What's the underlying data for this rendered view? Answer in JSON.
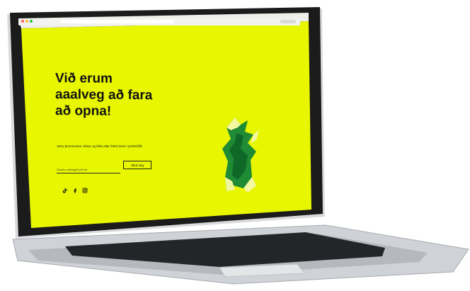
{
  "browser": {
    "dots": [
      "#ff5f57",
      "#febc2e",
      "#28c840"
    ],
    "url_placeholder": "",
    "controls": ""
  },
  "hero": {
    "headline": "Við erum\naaalveg að fara\nað opna!",
    "description": "Vertu þemmerieur cikkar og fáðu allar fréttir beint í pósthólfið.",
    "email_placeholder": "Skráðu netfangið þitt hér",
    "signup_label": "Skrá mig",
    "social_icons": [
      "tiktok-icon",
      "facebook-icon",
      "instagram-icon"
    ]
  },
  "colors": {
    "brand_yellow": "#e8f600",
    "hole_green": "#1f8b35",
    "text_dark": "#121212"
  }
}
